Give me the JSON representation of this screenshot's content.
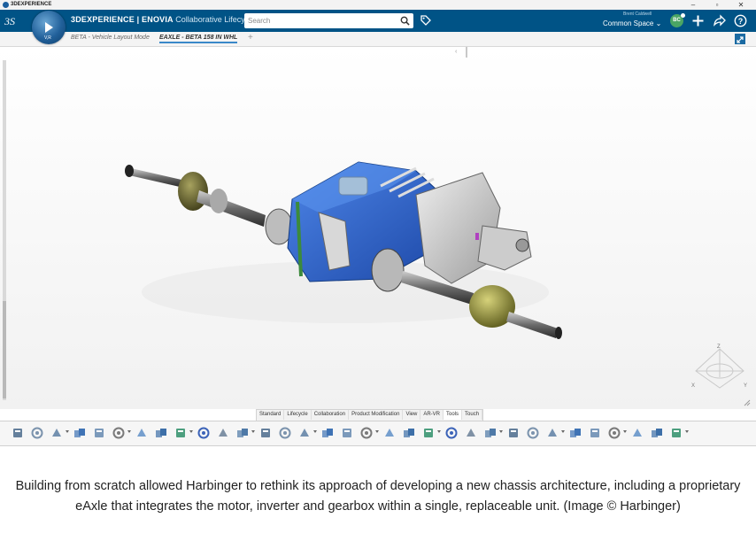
{
  "window": {
    "title": "3DEXPERIENCE",
    "minimize_glyph": "–",
    "maximize_glyph": "▫",
    "close_glyph": "✕"
  },
  "header": {
    "brand_prefix": "3DEXPERIENCE | ENOVIA",
    "brand_app": "Collaborative Lifecycle",
    "search_placeholder": "Search",
    "user_name": "Brent Caldwell",
    "space_label": "Common Space",
    "avatar_initials": "BC",
    "compass_label": "V,R",
    "accent": "#005386"
  },
  "tabs": [
    {
      "label": "BETA - Vehicle Layout Mode"
    },
    {
      "label": "EAXLE - BETA 158 IN WHL"
    }
  ],
  "tab_add": "+",
  "collapse_handle": "‹",
  "action_tabs": [
    "Standard",
    "Lifecycle",
    "Collaboration",
    "Product Modification",
    "View",
    "AR-VR",
    "Tools",
    "Touch"
  ],
  "active_action_tab": "Tools",
  "toolbar_icons": [
    "scissors-icon",
    "copy-icon",
    "paste-icon",
    "undo-icon",
    "zoom-icon",
    "vehicle-icon",
    "insert-icon",
    "table-icon",
    "catalog-icon",
    "star-icon",
    "list-icon",
    "tree-icon",
    "settings-icon",
    "flip-icon",
    "cube-icon",
    "refresh-icon",
    "measure-icon",
    "section-icon",
    "formula-icon",
    "wand-icon",
    "grid-icon",
    "render-icon",
    "sphere-icon",
    "mesh-icon",
    "gauge-icon",
    "panel-icon",
    "material-icon",
    "pen-icon",
    "eraser-icon",
    "paint-icon",
    "spin-icon",
    "share-icon",
    "export-icon"
  ],
  "compass_axes": {
    "x": "X",
    "y": "Y",
    "z": "Z"
  },
  "colors": {
    "housing": "#2b63c9",
    "gearbox": "#c9c9c9",
    "boot": "#8a8a36"
  },
  "caption": "Building from scratch allowed Harbinger to rethink its approach of developing a new chassis architecture, including a proprietary eAxle that integrates the motor, inverter and gearbox within a single, replaceable unit. (Image © Harbinger)"
}
